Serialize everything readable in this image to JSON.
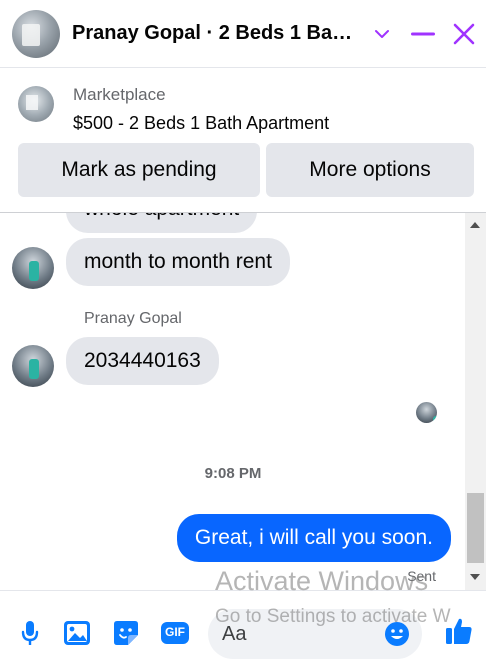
{
  "header": {
    "title": "Pranay Gopal · 2 Beds 1 Ba…",
    "icons": [
      "chevron-down-icon",
      "minimize-icon",
      "close-icon"
    ],
    "accent": "#a033ff"
  },
  "marketplace": {
    "label": "Marketplace",
    "listing": "$500 - 2 Beds 1 Bath Apartment",
    "buttons": {
      "pending": "Mark as pending",
      "more": "More options"
    }
  },
  "chat": {
    "partial_message": "whole apartment",
    "messages_in": [
      {
        "text": "month to month rent"
      },
      {
        "text": "2034440163"
      }
    ],
    "sender_name": "Pranay Gopal",
    "timestamp": "9:08 PM",
    "message_out": "Great, i will call you soon.",
    "status": "Sent"
  },
  "composer": {
    "placeholder": "Aa",
    "icons": [
      "microphone-icon",
      "image-icon",
      "sticker-icon",
      "gif-icon",
      "emoji-icon",
      "like-icon"
    ],
    "gif_label": "GIF"
  },
  "watermark": {
    "line1": "Activate Windows",
    "line2": "Go to Settings to activate W"
  },
  "colors": {
    "messenger_blue": "#0866ff",
    "bubble_gray": "#e4e6eb",
    "icon_blue": "#0a7cff"
  }
}
